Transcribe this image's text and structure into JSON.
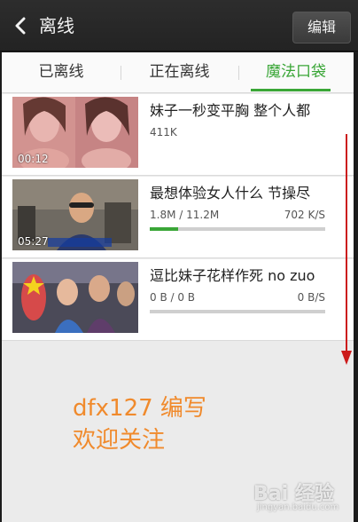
{
  "header": {
    "title": "离线",
    "edit_label": "编辑"
  },
  "tabs": [
    {
      "label": "已离线",
      "active": false
    },
    {
      "label": "正在离线",
      "active": false
    },
    {
      "label": "魔法口袋",
      "active": true
    }
  ],
  "items": [
    {
      "title": "妹子一秒变平胸 整个人都",
      "duration": "00:12",
      "size": "411K",
      "speed": "",
      "progress": null
    },
    {
      "title": "最想体验女人什么 节操尽",
      "duration": "05:27",
      "size": "1.8M / 11.2M",
      "speed": "702 K/S",
      "progress": 0.16
    },
    {
      "title": "逗比妹子花样作死 no zuo",
      "duration": "",
      "size": "0 B / 0 B",
      "speed": "0 B/S",
      "progress": 0
    }
  ],
  "note": {
    "line1_name": "dfx127",
    "line1_rest": " 编写",
    "line2": "欢迎关注"
  },
  "watermark": {
    "text": "Bai 经验",
    "sub": "jingyan.baidu.com"
  },
  "colors": {
    "accent": "#3aa637",
    "note": "#f08a2c",
    "scroll_arrow": "#cc1b1b"
  }
}
